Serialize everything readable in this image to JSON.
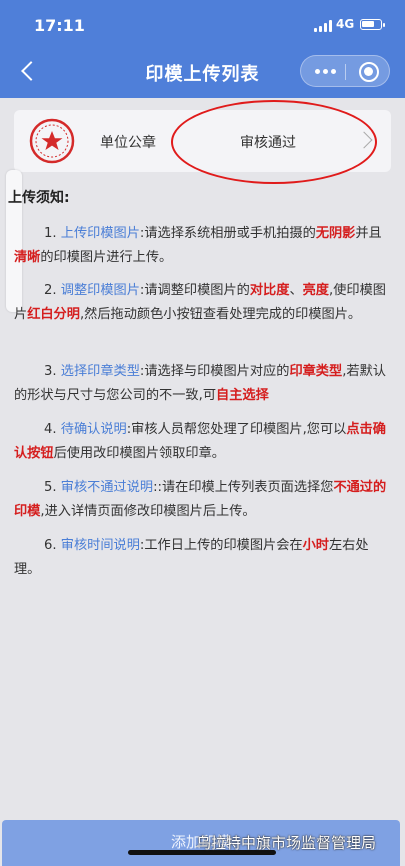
{
  "status_bar": {
    "time": "17:11",
    "network": "4G"
  },
  "nav": {
    "title": "印模上传列表"
  },
  "seal_item": {
    "name": "单位公章",
    "status": "审核通过"
  },
  "notice": {
    "heading": "上传须知:",
    "items": [
      {
        "num": "1.",
        "title": "上传印模图片",
        "t1": ":请选择系统相册或手机拍摄的",
        "r1": "无阴影",
        "t2": "并且",
        "r2": "清晰",
        "t3": "的印模图片进行上传。"
      },
      {
        "num": "2.",
        "title": "调整印模图片",
        "t1": ":请调整印模图片的",
        "r1": "对比度",
        "t2": "、",
        "r2": "亮度",
        "t3": ",使印模图片",
        "r3": "红白分明",
        "t4": ",然后拖动颜色小按钮查看处理完成的印模图片。"
      },
      {
        "num": "3.",
        "title": "选择印章类型",
        "t1": ":请选择与印模图片对应的",
        "r1": "印章类型",
        "t2": ",若默认的形状与尺寸与您公司的不一致,可",
        "r2": "自主选择"
      },
      {
        "num": "4.",
        "title": "待确认说明",
        "t1": ":审核人员帮您处理了印模图片,您可以",
        "r1": "点击确认按钮",
        "t2": "后使用改印模图片领取印章。"
      },
      {
        "num": "5.",
        "title": "审核不通过说明",
        "t1": "::请在印模上传列表页面选择您",
        "r1": "不通过的印模",
        "t2": ",进入详情页面修改印模图片后上传。"
      },
      {
        "num": "6.",
        "title": "审核时间说明",
        "t1": ":工作日上传的印模图片会在",
        "r1": "小时",
        "t2": "左右处理。"
      }
    ]
  },
  "add_button": {
    "label": "添加印模"
  },
  "watermark": "乌拉特中旗市场监督管理局",
  "colors": {
    "primary": "#4f7fd9",
    "accent_blue": "#4a7ed6",
    "highlight_red": "#d51e1e",
    "annotation": "#e01b1b"
  },
  "icons": [
    "back-arrow-icon",
    "more-dots-icon",
    "target-icon",
    "chevron-right-icon",
    "signal-icon",
    "battery-icon",
    "seal-stamp-icon"
  ]
}
